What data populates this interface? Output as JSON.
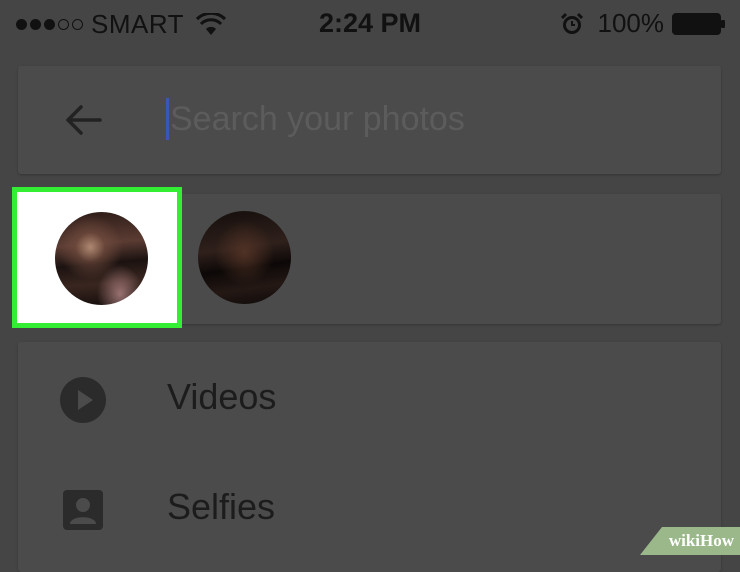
{
  "status_bar": {
    "signal_dots_filled": 3,
    "signal_dots_empty": 2,
    "carrier": "SMART",
    "time": "2:24 PM",
    "battery_percent": "100%",
    "icons": [
      "wifi-icon",
      "alarm-icon",
      "battery-icon"
    ]
  },
  "search": {
    "placeholder": "Search your photos",
    "value": "",
    "back_icon": "arrow-back-icon"
  },
  "faces": {
    "items": [
      {
        "selected": true
      },
      {
        "selected": false
      }
    ],
    "highlight_color": "#33ee33"
  },
  "categories": {
    "items": [
      {
        "label": "Videos",
        "icon": "play-circle-icon"
      },
      {
        "label": "Selfies",
        "icon": "portrait-icon"
      }
    ]
  },
  "watermark": {
    "text": "wikiHow"
  },
  "colors": {
    "overlay_background": "#454545",
    "card_background": "#4b4b4b",
    "caret": "#3a57b5"
  }
}
